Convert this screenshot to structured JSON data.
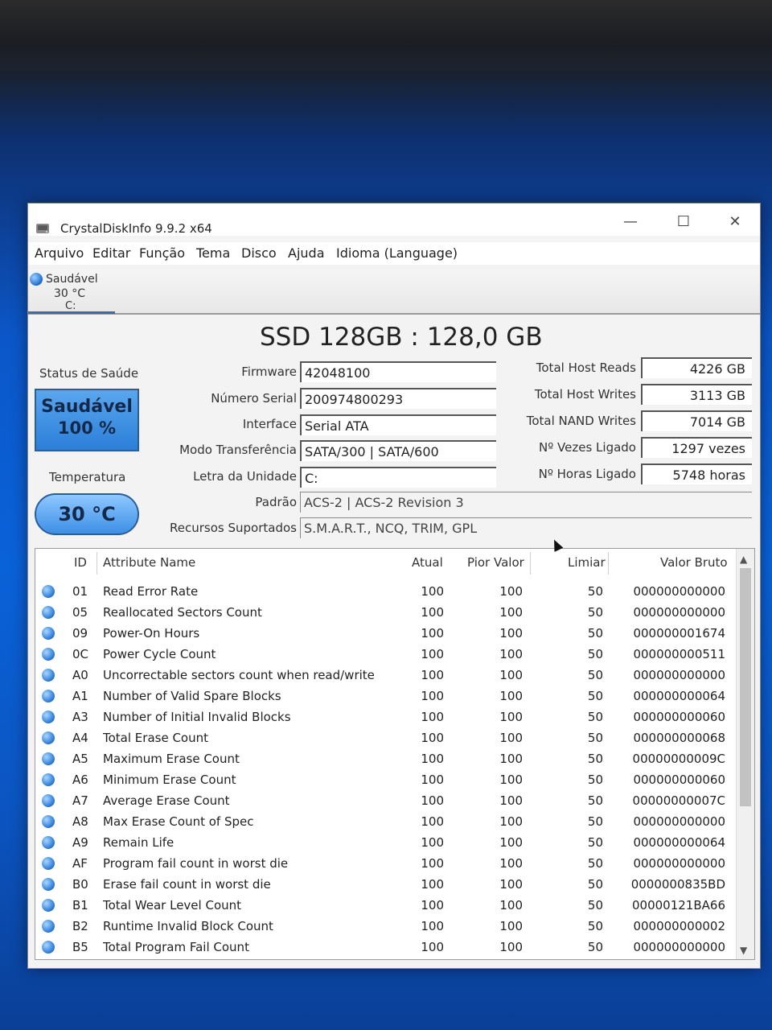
{
  "window": {
    "title": "CrystalDiskInfo 9.9.2 x64",
    "controls": {
      "minimize": "—",
      "maximize": "☐",
      "close": "✕"
    }
  },
  "menu": [
    "Arquivo",
    "Editar",
    "Função",
    "Tema",
    "Disco",
    "Ajuda",
    "Idioma (Language)"
  ],
  "disk_tab": {
    "status": "Saudável",
    "temp": "30 °C",
    "drive": "C:"
  },
  "model": "SSD 128GB : 128,0 GB",
  "health": {
    "label": "Status de Saúde",
    "status": "Saudável",
    "percent": "100 %"
  },
  "temperature": {
    "label": "Temperatura",
    "value": "30 °C"
  },
  "info": {
    "firmware_label": "Firmware",
    "firmware": "42048100",
    "serial_label": "Número Serial",
    "serial": "200974800293",
    "interface_label": "Interface",
    "interface": "Serial ATA",
    "transfer_label": "Modo Transferência",
    "transfer": "SATA/300 | SATA/600",
    "drive_label": "Letra da Unidade",
    "drive": "C:",
    "standard_label": "Padrão",
    "standard": "ACS-2 | ACS-2 Revision 3",
    "features_label": "Recursos Suportados",
    "features": "S.M.A.R.T., NCQ, TRIM, GPL"
  },
  "stats": {
    "host_reads_label": "Total Host Reads",
    "host_reads": "4226 GB",
    "host_writes_label": "Total Host Writes",
    "host_writes": "3113 GB",
    "nand_writes_label": "Total NAND Writes",
    "nand_writes": "7014 GB",
    "power_count_label": "Nº Vezes Ligado",
    "power_count": "1297 vezes",
    "power_hours_label": "Nº Horas Ligado",
    "power_hours": "5748 horas"
  },
  "table": {
    "headers": {
      "id": "ID",
      "name": "Attribute Name",
      "current": "Atual",
      "worst": "Pior Valor",
      "threshold": "Limiar",
      "raw": "Valor Bruto"
    },
    "rows": [
      {
        "id": "01",
        "name": "Read Error Rate",
        "current": "100",
        "worst": "100",
        "threshold": "50",
        "raw": "000000000000"
      },
      {
        "id": "05",
        "name": "Reallocated Sectors Count",
        "current": "100",
        "worst": "100",
        "threshold": "50",
        "raw": "000000000000"
      },
      {
        "id": "09",
        "name": "Power-On Hours",
        "current": "100",
        "worst": "100",
        "threshold": "50",
        "raw": "000000001674"
      },
      {
        "id": "0C",
        "name": "Power Cycle Count",
        "current": "100",
        "worst": "100",
        "threshold": "50",
        "raw": "000000000511"
      },
      {
        "id": "A0",
        "name": "Uncorrectable sectors count when read/write",
        "current": "100",
        "worst": "100",
        "threshold": "50",
        "raw": "000000000000"
      },
      {
        "id": "A1",
        "name": "Number of Valid Spare Blocks",
        "current": "100",
        "worst": "100",
        "threshold": "50",
        "raw": "000000000064"
      },
      {
        "id": "A3",
        "name": "Number of Initial Invalid Blocks",
        "current": "100",
        "worst": "100",
        "threshold": "50",
        "raw": "000000000060"
      },
      {
        "id": "A4",
        "name": "Total Erase Count",
        "current": "100",
        "worst": "100",
        "threshold": "50",
        "raw": "000000000068"
      },
      {
        "id": "A5",
        "name": "Maximum Erase Count",
        "current": "100",
        "worst": "100",
        "threshold": "50",
        "raw": "00000000009C"
      },
      {
        "id": "A6",
        "name": "Minimum Erase Count",
        "current": "100",
        "worst": "100",
        "threshold": "50",
        "raw": "000000000060"
      },
      {
        "id": "A7",
        "name": "Average Erase Count",
        "current": "100",
        "worst": "100",
        "threshold": "50",
        "raw": "00000000007C"
      },
      {
        "id": "A8",
        "name": "Max Erase Count of Spec",
        "current": "100",
        "worst": "100",
        "threshold": "50",
        "raw": "000000000000"
      },
      {
        "id": "A9",
        "name": "Remain Life",
        "current": "100",
        "worst": "100",
        "threshold": "50",
        "raw": "000000000064"
      },
      {
        "id": "AF",
        "name": "Program fail count in worst die",
        "current": "100",
        "worst": "100",
        "threshold": "50",
        "raw": "000000000000"
      },
      {
        "id": "B0",
        "name": "Erase fail count in worst die",
        "current": "100",
        "worst": "100",
        "threshold": "50",
        "raw": "0000000835BD"
      },
      {
        "id": "B1",
        "name": "Total Wear Level Count",
        "current": "100",
        "worst": "100",
        "threshold": "50",
        "raw": "00000121BA66"
      },
      {
        "id": "B2",
        "name": "Runtime Invalid Block Count",
        "current": "100",
        "worst": "100",
        "threshold": "50",
        "raw": "000000000002"
      },
      {
        "id": "B5",
        "name": "Total Program Fail Count",
        "current": "100",
        "worst": "100",
        "threshold": "50",
        "raw": "000000000000"
      }
    ]
  }
}
